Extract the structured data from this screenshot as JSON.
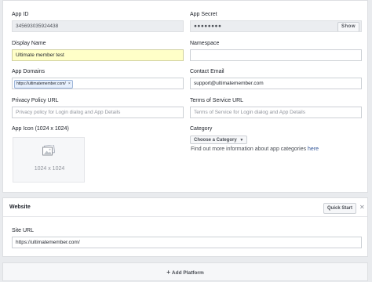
{
  "settings": {
    "app_id_label": "App ID",
    "app_id_value": "345693035924438",
    "app_secret_label": "App Secret",
    "app_secret_value": "●●●●●●●●",
    "show_label": "Show",
    "display_name_label": "Display Name",
    "display_name_value": "Ultimate member test",
    "namespace_label": "Namespace",
    "namespace_value": "",
    "app_domains_label": "App Domains",
    "app_domain_tag": "https://ultimatemember.com/",
    "app_domain_tag_remove": "×",
    "contact_email_label": "Contact Email",
    "contact_email_value": "support@ultimatemember.com",
    "privacy_url_label": "Privacy Policy URL",
    "privacy_url_placeholder": "Privacy policy for Login dialog and App Details",
    "tos_url_label": "Terms of Service URL",
    "tos_url_placeholder": "Terms of Service for Login dialog and App Details",
    "app_icon_label": "App Icon (1024 x 1024)",
    "app_icon_size_text": "1024 x 1024",
    "category_label": "Category",
    "category_dropdown_label": "Choose a Category",
    "category_help_text": "Find out more information about app categories ",
    "category_help_link": "here",
    "icons": {
      "image_placeholder": "image-icon",
      "dropdown_caret": "caret-down-icon"
    }
  },
  "website": {
    "title": "Website",
    "quick_start_label": "Quick Start",
    "close_label": "✕",
    "site_url_label": "Site URL",
    "site_url_value": "https://ultimatemember.com/"
  },
  "add_platform": {
    "plus": "+",
    "label": "Add Platform"
  },
  "colors": {
    "background": "#e9ebee",
    "panel": "#ffffff",
    "highlight_field": "#ffffc8",
    "link": "#365899"
  }
}
